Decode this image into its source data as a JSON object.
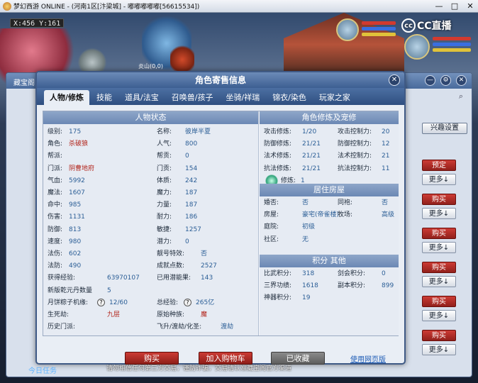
{
  "window": {
    "title": "梦幻西游 ONLINE - (河南1区[汴梁城] - 嘟嘟嘟嘟嘟[56615534])",
    "min": "—",
    "max": "□",
    "close": "✕"
  },
  "game": {
    "coord": "X:456 Y:161",
    "extra": "炎山(0,0)",
    "watermark": "CC直播",
    "watermark_logo": "cc"
  },
  "behind": {
    "title": "藏宝阁",
    "interest_label": "兴趣设置",
    "buttons": [
      "预定",
      "更多↓",
      "购买",
      "更多↓",
      "购买",
      "更多↓",
      "购买",
      "更多↓",
      "购买",
      "更多↓",
      "购买",
      "更多↓"
    ]
  },
  "dialog": {
    "title": "角色寄售信息",
    "close": "✕",
    "tabs": [
      "人物/修炼",
      "技能",
      "道具/法宝",
      "召唤兽/孩子",
      "坐骑/祥瑞",
      "锦衣/染色",
      "玩家之家"
    ],
    "active_tab": "人物/修炼",
    "status_title": "人物状态",
    "left": [
      {
        "k": "级别:",
        "v": "175"
      },
      {
        "k": "角色:",
        "v": "杀破狼"
      },
      {
        "k": "帮派:",
        "v": ""
      },
      {
        "k": "门派:",
        "v": "阴曹地府"
      },
      {
        "k": "气血:",
        "v": "5992"
      },
      {
        "k": "魔法:",
        "v": "1607"
      },
      {
        "k": "命中:",
        "v": "985"
      },
      {
        "k": "伤害:",
        "v": "1131"
      },
      {
        "k": "防御:",
        "v": "813"
      },
      {
        "k": "速度:",
        "v": "980"
      },
      {
        "k": "法伤:",
        "v": "602"
      },
      {
        "k": "法防:",
        "v": "490"
      },
      {
        "k": "获得经验:",
        "v": "63970107"
      },
      {
        "k": "新版乾元丹数量",
        "v": "5"
      },
      {
        "k": "月饼粽子机缘:",
        "v": "12/60"
      },
      {
        "k": "生死劫:",
        "v": "九层"
      },
      {
        "k": "历史门派:",
        "v": ""
      }
    ],
    "mid": [
      {
        "k": "名称:",
        "v": "彼岸半夏"
      },
      {
        "k": "人气:",
        "v": "800"
      },
      {
        "k": "帮贡:",
        "v": "0"
      },
      {
        "k": "门贡:",
        "v": "154"
      },
      {
        "k": "体质:",
        "v": "242"
      },
      {
        "k": "魔力:",
        "v": "187"
      },
      {
        "k": "力量:",
        "v": "187"
      },
      {
        "k": "耐力:",
        "v": "186"
      },
      {
        "k": "敏捷:",
        "v": "1257"
      },
      {
        "k": "潜力:",
        "v": "0"
      },
      {
        "k": "靓号特效:",
        "v": "否"
      },
      {
        "k": "成就点数:",
        "v": "2527"
      },
      {
        "k": "已用潜能果:",
        "v": "143"
      },
      {
        "k": "总经验:",
        "v": "265亿"
      },
      {
        "k": "原始种族:",
        "v": "魔"
      },
      {
        "k": "飞升/渡劫/化圣:",
        "v": "渡劫"
      }
    ],
    "qmark": "?",
    "cultivation_title": "角色修炼及宠修",
    "cultivation": [
      {
        "k": "攻击修炼:",
        "v": "1/20",
        "k2": "攻击控制力:",
        "v2": "20"
      },
      {
        "k": "防御修炼:",
        "v": "21/21",
        "k2": "防御控制力:",
        "v2": "12"
      },
      {
        "k": "法术修炼:",
        "v": "21/21",
        "k2": "法术控制力:",
        "v2": "21"
      },
      {
        "k": "抗法修炼:",
        "v": "21/21",
        "k2": "抗法控制力:",
        "v2": "11"
      },
      {
        "k": "猎术修炼:",
        "v": "1",
        "k2": "",
        "v2": ""
      }
    ],
    "house_title": "居住房屋",
    "house": [
      {
        "k": "婚否:",
        "v": "否",
        "k2": "同袍:",
        "v2": "否"
      },
      {
        "k": "房屋:",
        "v": "豪宅(帝雀楼)",
        "k2": "牧场:",
        "v2": "高级"
      },
      {
        "k": "庭院:",
        "v": "初级",
        "k2": "",
        "v2": ""
      },
      {
        "k": "社区:",
        "v": "无",
        "k2": "",
        "v2": ""
      }
    ],
    "score_title": "积分 其他",
    "score": [
      {
        "k": "比武积分:",
        "v": "318",
        "k2": "剑会积分:",
        "v2": "0"
      },
      {
        "k": "三界功绩:",
        "v": "1618",
        "k2": "副本积分:",
        "v2": "899"
      },
      {
        "k": "神器积分:",
        "v": "19",
        "k2": "",
        "v2": ""
      }
    ],
    "buy": "购买",
    "cart": "加入购物车",
    "collected": "已收藏",
    "web_link": "使用网页版"
  },
  "footer": {
    "task": "今日任务",
    "notice": "请勿相信任何第三方交易，谨防诈骗，交易请认准藏宝阁官方渠道"
  }
}
